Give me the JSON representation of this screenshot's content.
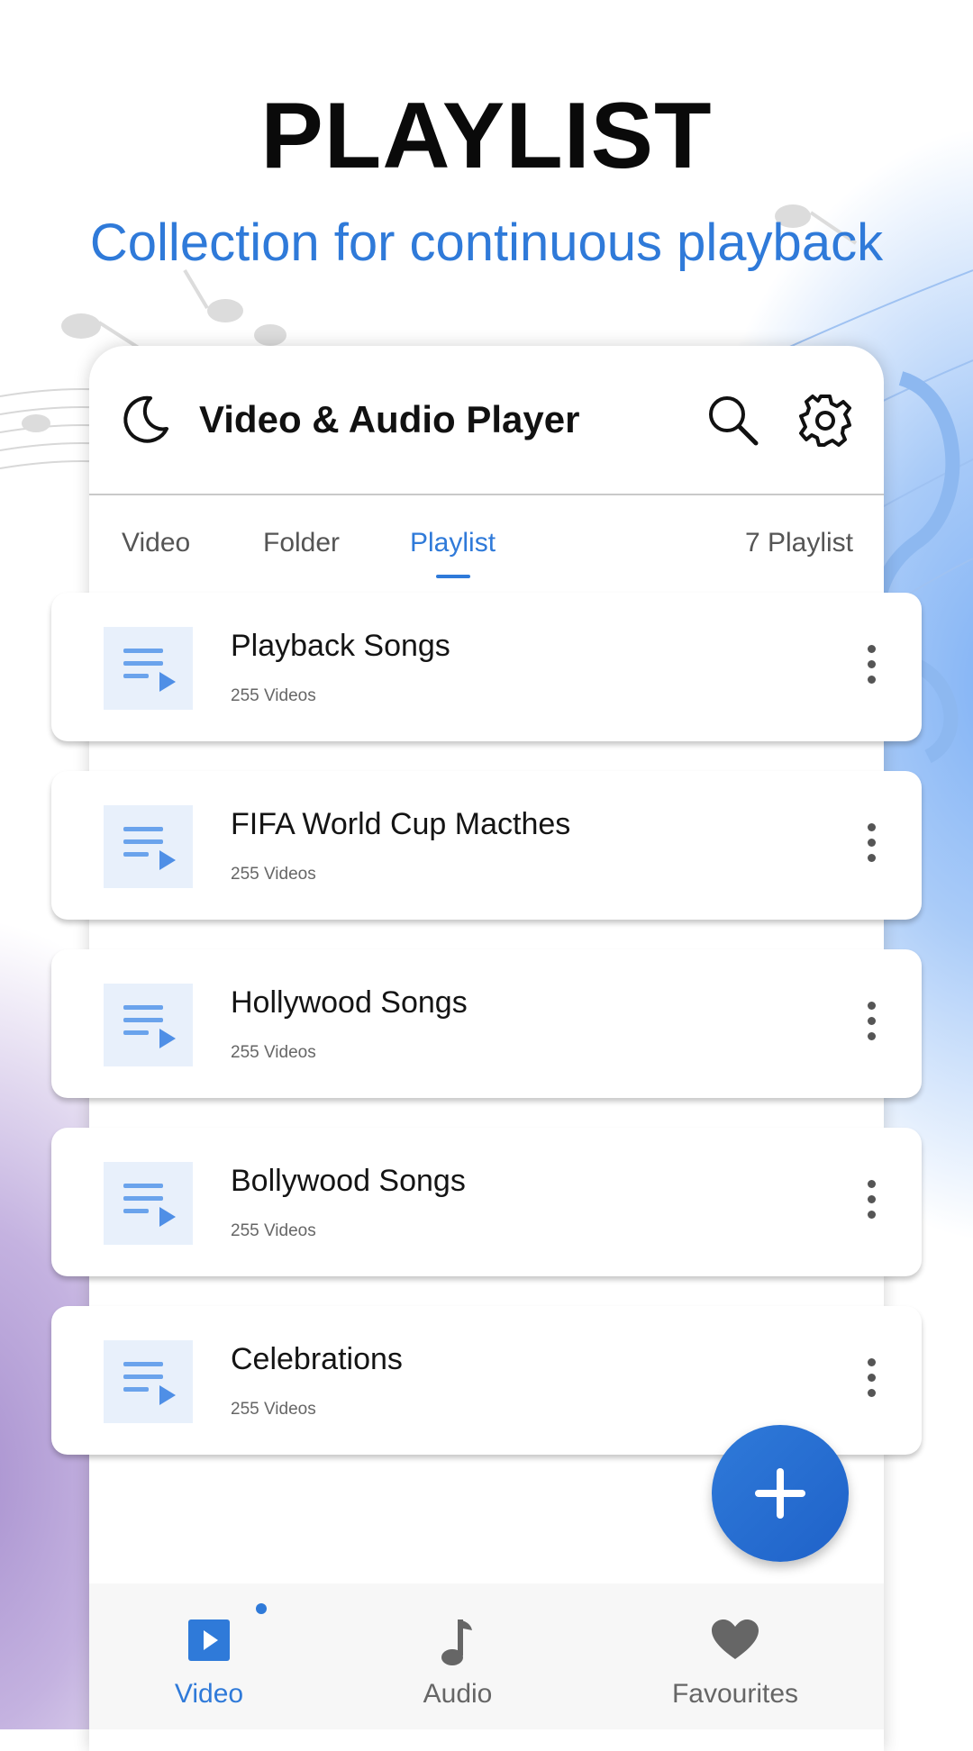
{
  "promo": {
    "headline": "PLAYLIST",
    "subline": "Collection for continuous playback"
  },
  "app": {
    "title": "Video & Audio Player",
    "icons": {
      "theme": "moon-icon",
      "search": "search-icon",
      "settings": "gear-icon"
    }
  },
  "tabs": [
    {
      "label": "Video",
      "active": false
    },
    {
      "label": "Folder",
      "active": false
    },
    {
      "label": "Playlist",
      "active": true
    }
  ],
  "playlist_count": "7 Playlist",
  "playlists": [
    {
      "title": "Playback Songs",
      "subtitle": "255 Videos"
    },
    {
      "title": "FIFA World Cup Macthes",
      "subtitle": "255 Videos"
    },
    {
      "title": "Hollywood Songs",
      "subtitle": "255 Videos"
    },
    {
      "title": "Bollywood Songs",
      "subtitle": "255 Videos"
    },
    {
      "title": "Celebrations",
      "subtitle": "255 Videos"
    }
  ],
  "bottom_nav": [
    {
      "label": "Video",
      "icon": "video-icon",
      "active": true
    },
    {
      "label": "Audio",
      "icon": "music-note-icon",
      "active": false
    },
    {
      "label": "Favourites",
      "icon": "heart-icon",
      "active": false
    }
  ],
  "colors": {
    "accent": "#2f7ad9",
    "text": "#141414",
    "muted": "#666666"
  }
}
